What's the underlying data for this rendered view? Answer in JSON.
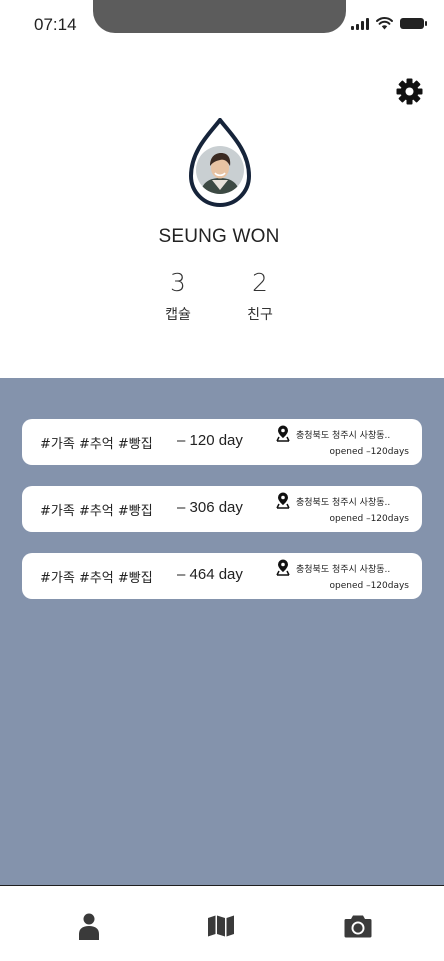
{
  "status_bar": {
    "time": "07:14",
    "icons": [
      "signal-icon",
      "wifi-icon",
      "battery-icon"
    ]
  },
  "header": {
    "settings_icon": "gear-icon"
  },
  "profile": {
    "name": "SEUNG WON",
    "stats": [
      {
        "value": "3",
        "label": "캡슐"
      },
      {
        "value": "2",
        "label": "친구"
      }
    ]
  },
  "capsules": [
    {
      "tags": "#가족 #추억 #빵집",
      "days": "– 120 day",
      "location": "충청북도 청주시 사창동..",
      "opened": "opened –120days"
    },
    {
      "tags": "#가족 #추억 #빵집",
      "days": "– 306 day",
      "location": "충청북도 청주시 사창동..",
      "opened": "opened –120days"
    },
    {
      "tags": "#가족 #추억 #빵집",
      "days": "– 464 day",
      "location": "충청북도 청주시 사창동..",
      "opened": "opened –120days"
    }
  ],
  "bottom_nav": [
    {
      "icon": "person-icon"
    },
    {
      "icon": "map-icon"
    },
    {
      "icon": "camera-icon"
    }
  ],
  "colors": {
    "feed_background": "#8493ac",
    "avatar_outline": "#16243a",
    "text": "#222222"
  }
}
